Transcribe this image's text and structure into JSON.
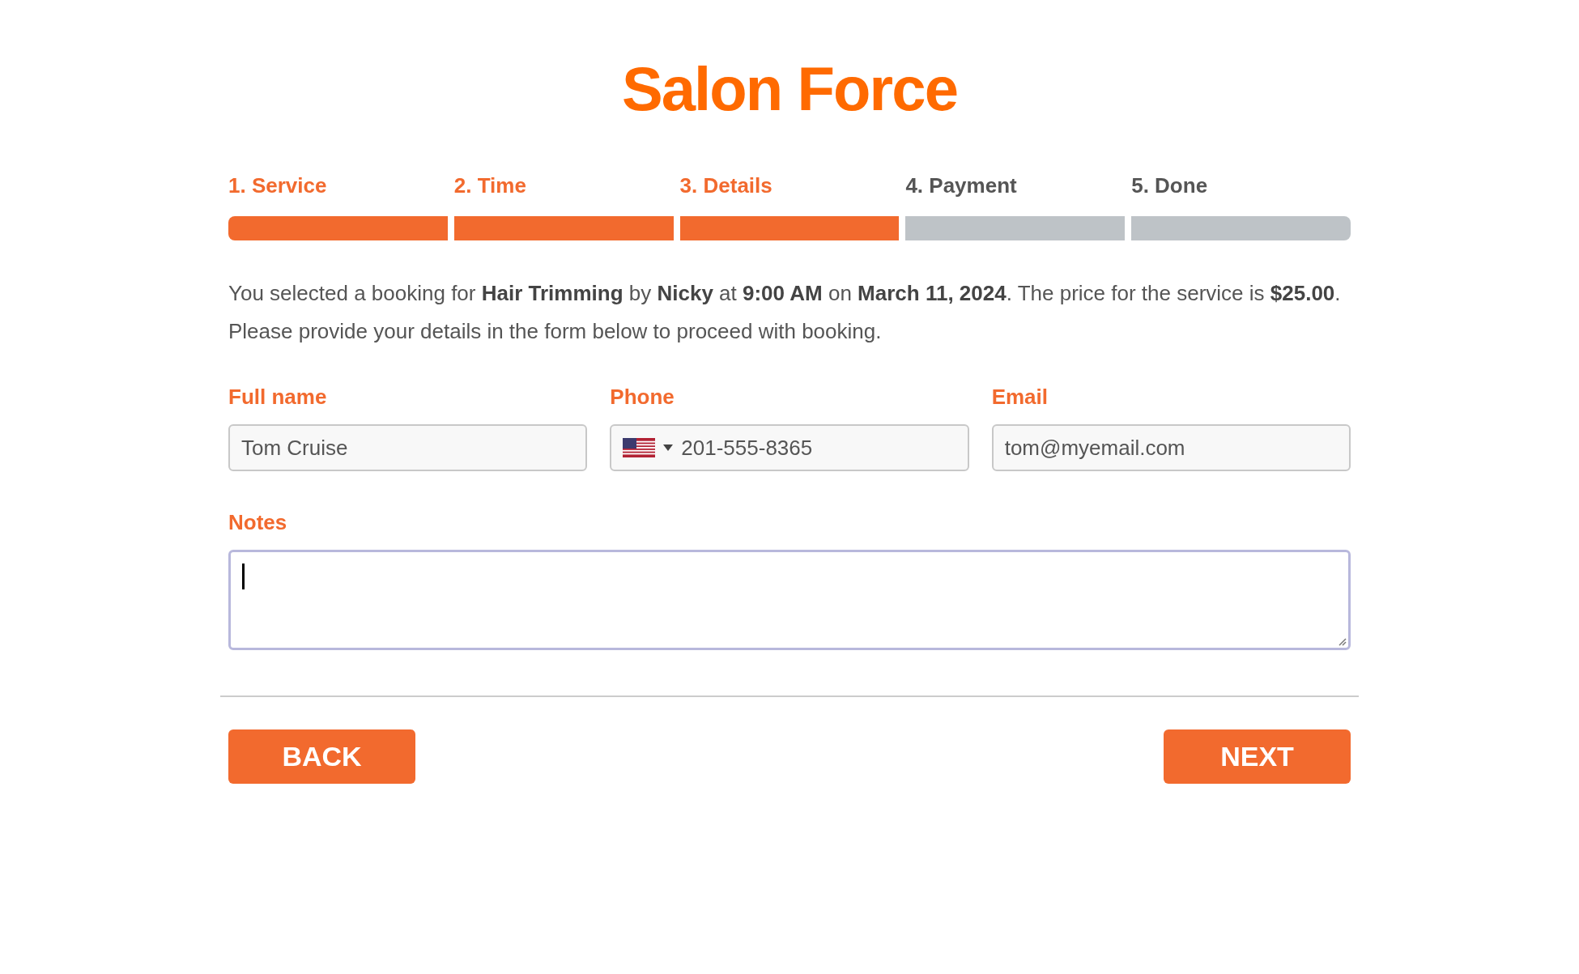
{
  "title": "Salon Force",
  "steps": [
    {
      "label": "1. Service",
      "completed": true
    },
    {
      "label": "2. Time",
      "completed": true
    },
    {
      "label": "3. Details",
      "completed": true
    },
    {
      "label": "4. Payment",
      "completed": false
    },
    {
      "label": "5. Done",
      "completed": false
    }
  ],
  "summary": "You selected a booking for **Hair Trimming** by **Nicky** at **9:00 AM** on **March 11, 2024**. The price for the service is **$25.00**.",
  "instruction": "Please provide your details in the form below to proceed with booking.",
  "fields": [
    {
      "kind": "text",
      "label": "Full name",
      "value": "Tom Cruise"
    },
    {
      "kind": "phone",
      "label": "Phone",
      "value": "201-555-8365"
    },
    {
      "kind": "text",
      "label": "Email",
      "value": "tom@myemail.com"
    }
  ],
  "notes": {
    "label": "Notes",
    "focused": true
  },
  "buttons": {
    "back": "BACK",
    "next": "NEXT"
  }
}
